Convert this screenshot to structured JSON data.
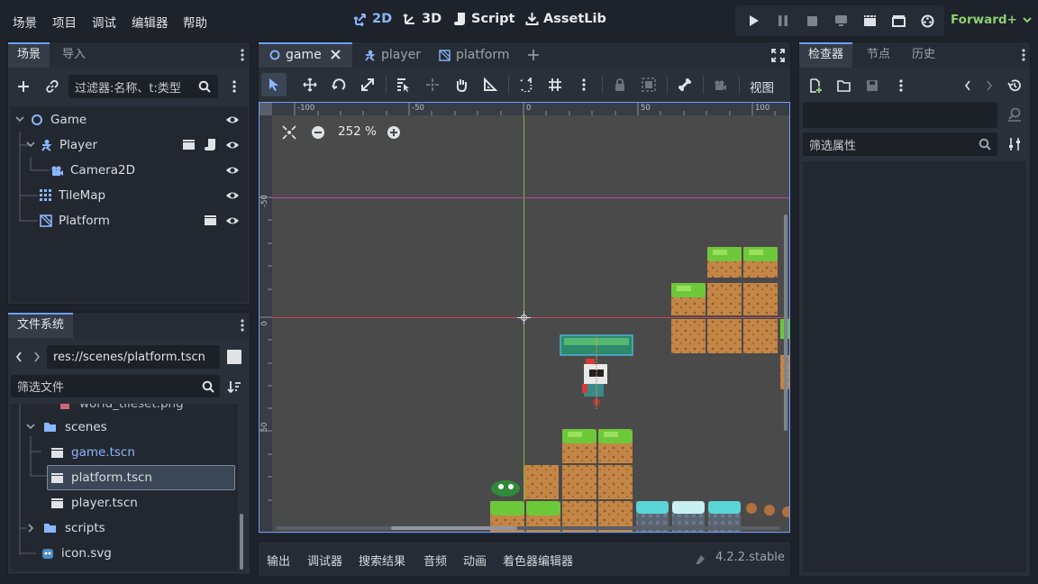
{
  "menu": [
    "场景",
    "项目",
    "调试",
    "编辑器",
    "帮助"
  ],
  "workspaces": {
    "w2d": "2D",
    "w3d": "3D",
    "script": "Script",
    "assetlib": "AssetLib"
  },
  "renderer": "Forward+",
  "scene_dock": {
    "tabs": [
      "场景",
      "导入"
    ],
    "filter_placeholder": "过滤器:名称、t:类型",
    "nodes": [
      "Game",
      "Player",
      "Camera2D",
      "TileMap",
      "Platform"
    ]
  },
  "fs_dock": {
    "tab": "文件系统",
    "path": "res://scenes/platform.tscn",
    "filter_placeholder": "筛选文件",
    "items": [
      "world_tileset.png",
      "scenes",
      "game.tscn",
      "platform.tscn",
      "player.tscn",
      "scripts",
      "icon.svg"
    ]
  },
  "editor_tabs": [
    "game",
    "player",
    "platform"
  ],
  "toolbar": {
    "view_label": "视图"
  },
  "zoom": "252 %",
  "ruler_x": [
    "-100",
    "-50",
    "0",
    "50",
    "100"
  ],
  "ruler_y": [
    "-50",
    "0",
    "50"
  ],
  "bottom_tabs": [
    "输出",
    "调试器",
    "搜索结果",
    "音频",
    "动画",
    "着色器编辑器"
  ],
  "version": "4.2.2.stable",
  "inspector": {
    "tabs": [
      "检查器",
      "节点",
      "历史"
    ],
    "filter_placeholder": "筛选属性"
  },
  "colors": {
    "accent": "#6aa1ff",
    "green": "#8bd16f"
  }
}
